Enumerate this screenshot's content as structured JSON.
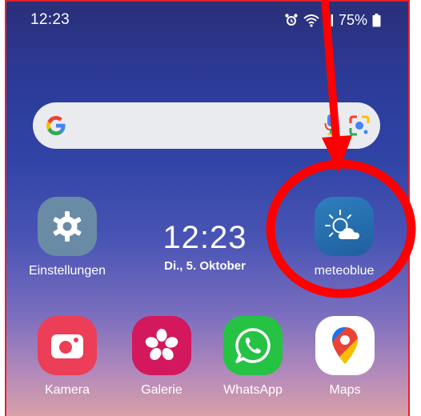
{
  "status_bar": {
    "time": "12:23",
    "battery_percent": "75%",
    "icons": [
      "alarm-icon",
      "wifi-icon",
      "signal-icon",
      "battery-icon"
    ]
  },
  "search_bar": {
    "icons": [
      "google-logo-icon",
      "microphone-icon",
      "google-lens-icon"
    ]
  },
  "clock_widget": {
    "time": "12:23",
    "date": "Di., 5. Oktober"
  },
  "apps": {
    "settings": {
      "label": "Einstellungen",
      "icon": "gear-icon"
    },
    "meteoblue": {
      "label": "meteoblue",
      "icon": "sun-cloud-icon"
    },
    "camera": {
      "label": "Kamera",
      "icon": "camera-icon"
    },
    "gallery": {
      "label": "Galerie",
      "icon": "flower-icon"
    },
    "whatsapp": {
      "label": "WhatsApp",
      "icon": "whatsapp-icon"
    },
    "maps": {
      "label": "Maps",
      "icon": "map-pin-icon"
    }
  },
  "annotation": {
    "color": "#ff0000",
    "shapes": [
      "arrow",
      "circle"
    ]
  }
}
